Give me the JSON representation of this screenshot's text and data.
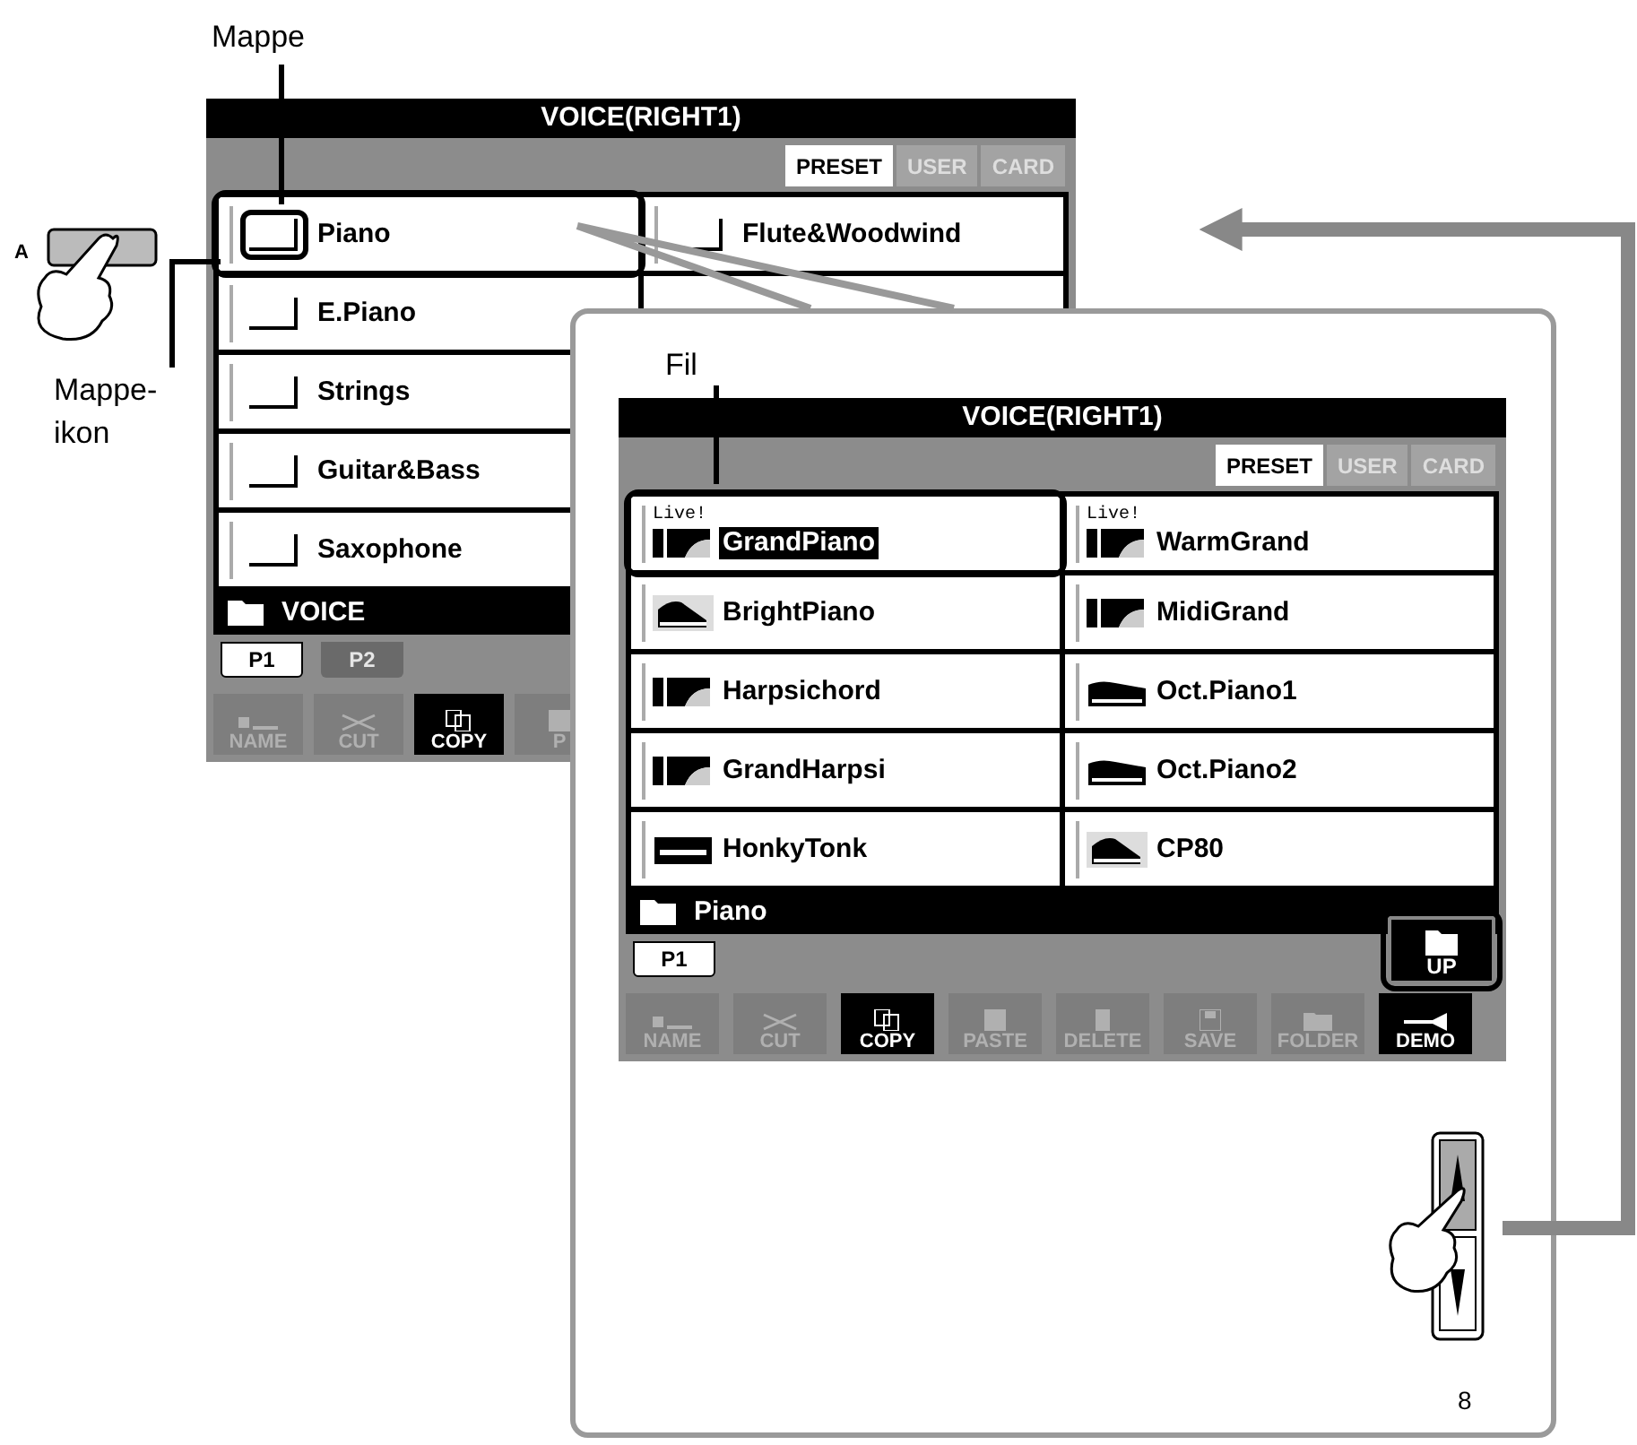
{
  "callouts": {
    "folder": "Mappe",
    "folder_icon": "Mappe-ikon",
    "file": "Fil"
  },
  "button_labels": {
    "a": "A",
    "scroll": "8"
  },
  "back_screen": {
    "title": "VOICE(RIGHT1)",
    "tabs": [
      {
        "label": "PRESET",
        "selected": true
      },
      {
        "label": "USER",
        "selected": false
      },
      {
        "label": "CARD",
        "selected": false
      }
    ],
    "columns": [
      [
        {
          "name": "Piano",
          "kind": "folder",
          "selected": false,
          "circled": true,
          "icon_circled": true
        },
        {
          "name": "E.Piano",
          "kind": "folder",
          "selected": false,
          "circled": false,
          "icon_circled": false
        },
        {
          "name": "Strings",
          "kind": "folder",
          "selected": false,
          "circled": false,
          "icon_circled": false
        },
        {
          "name": "Guitar&Bass",
          "kind": "folder",
          "selected": false,
          "circled": false,
          "icon_circled": false
        },
        {
          "name": "Saxophone",
          "kind": "folder",
          "selected": false,
          "circled": false,
          "icon_circled": false
        }
      ],
      [
        {
          "name": "Flute&Woodwind",
          "kind": "folder",
          "selected": false,
          "circled": false,
          "icon_circled": false
        }
      ]
    ],
    "folder_path": "VOICE",
    "pages": [
      {
        "label": "P1",
        "selected": true
      },
      {
        "label": "P2",
        "selected": false
      }
    ],
    "buttons": [
      {
        "label": "NAME",
        "kind": "name",
        "disabled": true
      },
      {
        "label": "CUT",
        "kind": "cut",
        "disabled": true
      },
      {
        "label": "COPY",
        "kind": "copy",
        "disabled": false
      },
      {
        "label": "P",
        "kind": "paste",
        "disabled": true
      }
    ]
  },
  "front_screen": {
    "title": "VOICE(RIGHT1)",
    "tabs": [
      {
        "label": "PRESET",
        "selected": true
      },
      {
        "label": "USER",
        "selected": false
      },
      {
        "label": "CARD",
        "selected": false
      }
    ],
    "columns": [
      [
        {
          "live": "Live!",
          "name": "GrandPiano",
          "kind": "grand",
          "selected": true,
          "circled": true
        },
        {
          "name": "BrightPiano",
          "kind": "upright",
          "selected": false,
          "circled": false
        },
        {
          "name": "Harpsichord",
          "kind": "grand",
          "selected": false,
          "circled": false
        },
        {
          "name": "GrandHarpsi",
          "kind": "grand",
          "selected": false,
          "circled": false
        },
        {
          "name": "HonkyTonk",
          "kind": "honky",
          "selected": false,
          "circled": false
        }
      ],
      [
        {
          "live": "Live!",
          "name": "WarmGrand",
          "kind": "grand",
          "selected": false,
          "circled": false
        },
        {
          "name": "MidiGrand",
          "kind": "grand",
          "selected": false,
          "circled": false
        },
        {
          "name": "Oct.Piano1",
          "kind": "octave",
          "selected": false,
          "circled": false
        },
        {
          "name": "Oct.Piano2",
          "kind": "octave",
          "selected": false,
          "circled": false
        },
        {
          "name": "CP80",
          "kind": "upright",
          "selected": false,
          "circled": false
        }
      ]
    ],
    "folder_path": "Piano",
    "up_button": {
      "label": "UP",
      "circled": true
    },
    "pages": [
      {
        "label": "P1",
        "selected": true
      }
    ],
    "buttons": [
      {
        "label": "NAME",
        "kind": "name",
        "disabled": true
      },
      {
        "label": "CUT",
        "kind": "cut",
        "disabled": true
      },
      {
        "label": "COPY",
        "kind": "copy",
        "disabled": false
      },
      {
        "label": "PASTE",
        "kind": "paste",
        "disabled": true
      },
      {
        "label": "DELETE",
        "kind": "delete",
        "disabled": true
      },
      {
        "label": "SAVE",
        "kind": "save",
        "disabled": true
      },
      {
        "label": "FOLDER",
        "kind": "folder",
        "disabled": true
      },
      {
        "label": "DEMO",
        "kind": "demo",
        "disabled": false
      }
    ]
  }
}
